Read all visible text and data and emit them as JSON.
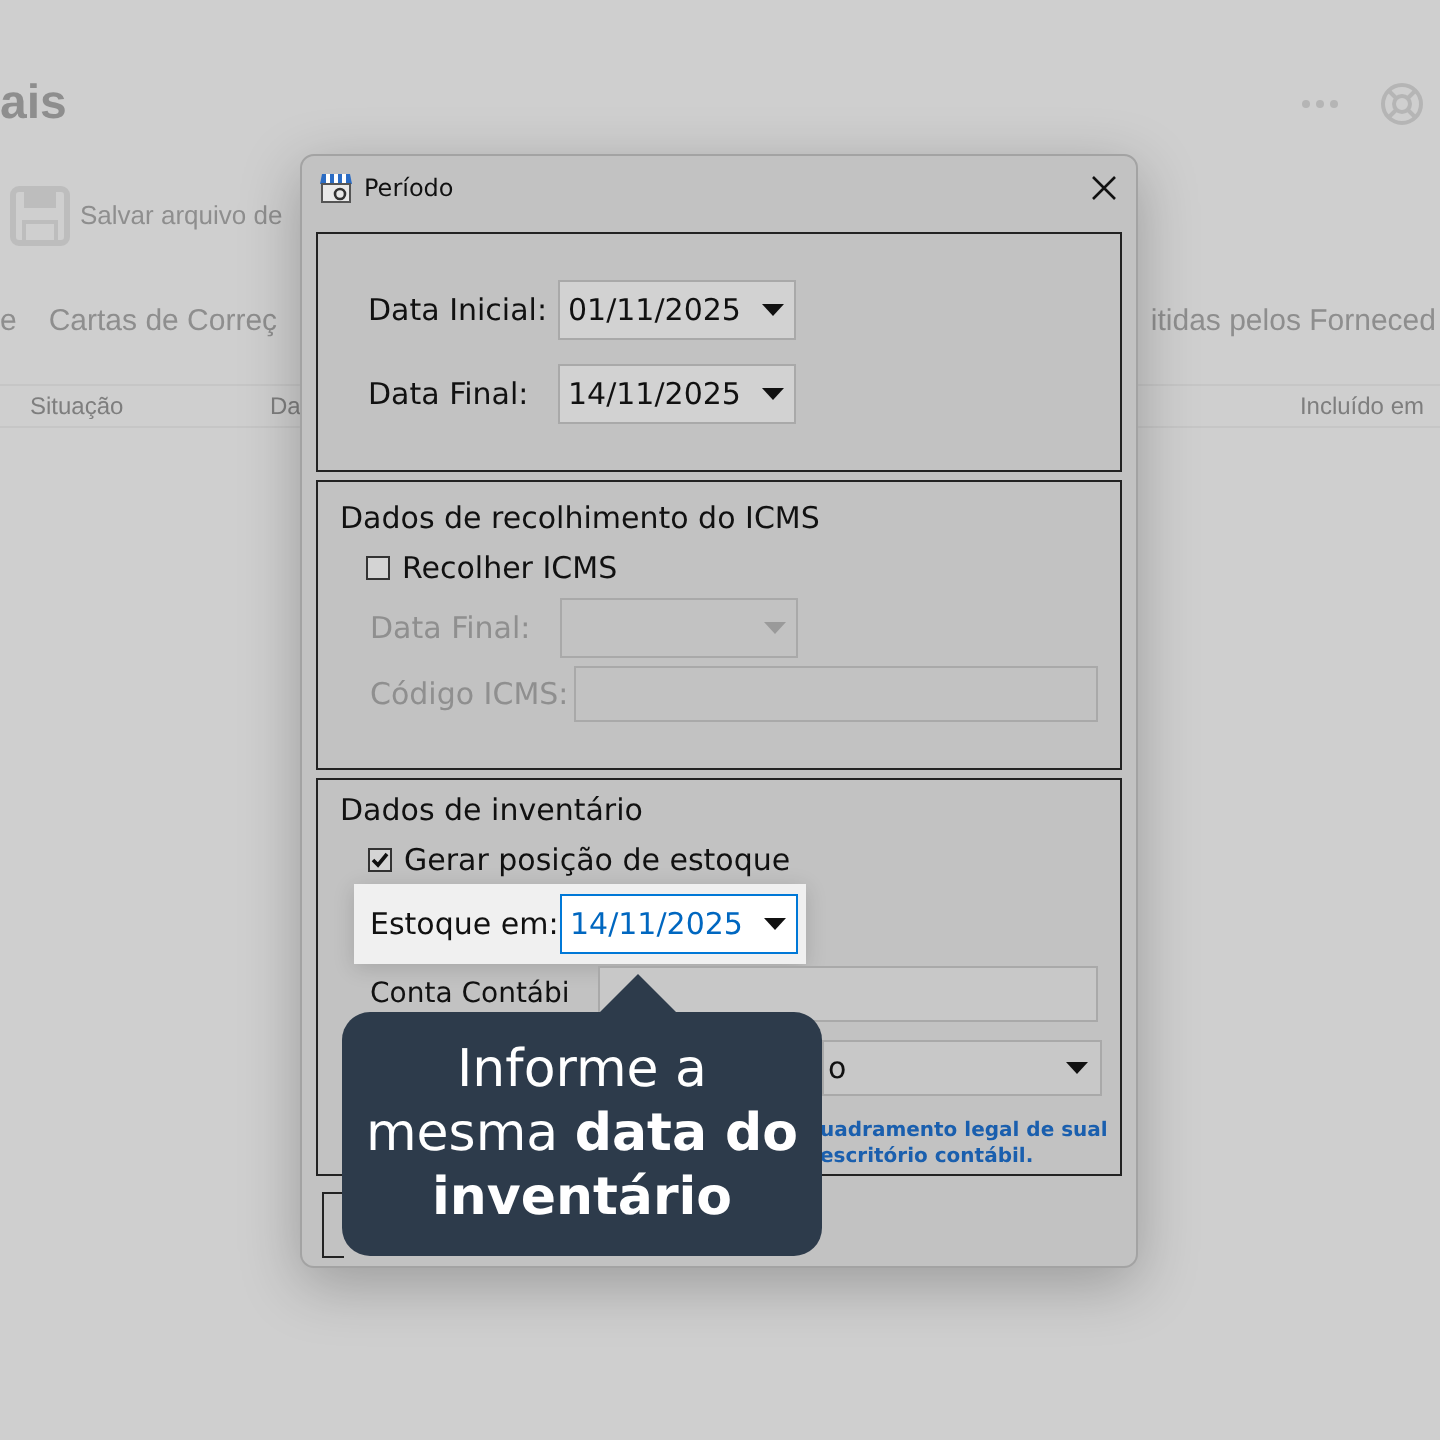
{
  "background": {
    "title": "ais",
    "toolbar_button": "Salvar arquivo de",
    "tab_labels": [
      "e",
      "Cartas de Correç",
      "itidas pelos Forneced"
    ],
    "columns": [
      "Situação",
      "Da",
      "Incluído em"
    ]
  },
  "dialog": {
    "title": "Período",
    "periodo": {
      "start_label": "Data Inicial:",
      "start": "01/11/2025",
      "end_label": "Data Final:",
      "end": "14/11/2025"
    },
    "icms": {
      "heading": "Dados de recolhimento do ICMS",
      "checkbox": {
        "label": "Recolher ICMS",
        "checked": false
      },
      "date_label": "Data Final:",
      "code_label": "Código ICMS:",
      "disabled": true
    },
    "inventario": {
      "heading": "Dados de inventário",
      "checkbox": {
        "label": "Gerar posição de estoque",
        "checked": true
      },
      "date_label": "Estoque em:",
      "date": "14/11/2025",
      "highlighted": true,
      "account_label": "Conta Contábi",
      "select_value": "o",
      "note_lines": [
        "uadramento legal de sual",
        "escritório contábil."
      ]
    }
  },
  "callout": {
    "lines": [
      "Informe a",
      "mesma **data do**",
      "**inventário**"
    ]
  }
}
